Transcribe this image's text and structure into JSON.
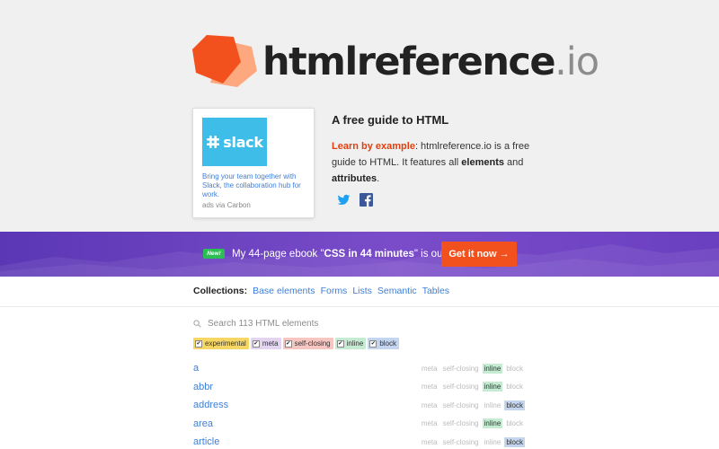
{
  "header": {
    "logo_main": "htmlreference",
    "logo_tld": ".io"
  },
  "ad": {
    "brand": "slack",
    "text": "Bring your team together with Slack, the collaboration hub for work.",
    "via": "ads via Carbon"
  },
  "intro": {
    "title": "A free guide to HTML",
    "learn": "Learn by example",
    "text_a": ": htmlreference.io is a free guide to HTML. It features all ",
    "elements": "elements",
    "text_b": " and ",
    "attributes": "attributes",
    "text_c": "."
  },
  "social": {
    "icons": [
      "twitter-icon",
      "facebook-icon"
    ]
  },
  "banner": {
    "badge": "New!",
    "text_a": "My 44-page ebook \"",
    "book": "CSS in 44 minutes",
    "text_b": "\" is out! ",
    "cta": "Get it now →"
  },
  "collections": {
    "label": "Collections:",
    "items": [
      "Base elements",
      "Forms",
      "Lists",
      "Semantic",
      "Tables"
    ]
  },
  "search": {
    "placeholder": "Search 113 HTML elements",
    "value": ""
  },
  "filters": [
    {
      "label": "experimental",
      "checked": true
    },
    {
      "label": "meta",
      "checked": true
    },
    {
      "label": "self-closing",
      "checked": true
    },
    {
      "label": "inline",
      "checked": true
    },
    {
      "label": "block",
      "checked": true
    }
  ],
  "tag_labels": [
    "meta",
    "self-closing",
    "inline",
    "block"
  ],
  "elements": [
    {
      "name": "a",
      "active": "inline"
    },
    {
      "name": "abbr",
      "active": "inline"
    },
    {
      "name": "address",
      "active": "block"
    },
    {
      "name": "area",
      "active": "inline"
    },
    {
      "name": "article",
      "active": "block"
    }
  ],
  "colors": {
    "accent": "#e33f0c",
    "link": "#3d7fd8",
    "cta": "#f2511e",
    "banner": "#6a3fc0",
    "new_badge": "#2cbd55",
    "slack": "#3ebde8"
  }
}
